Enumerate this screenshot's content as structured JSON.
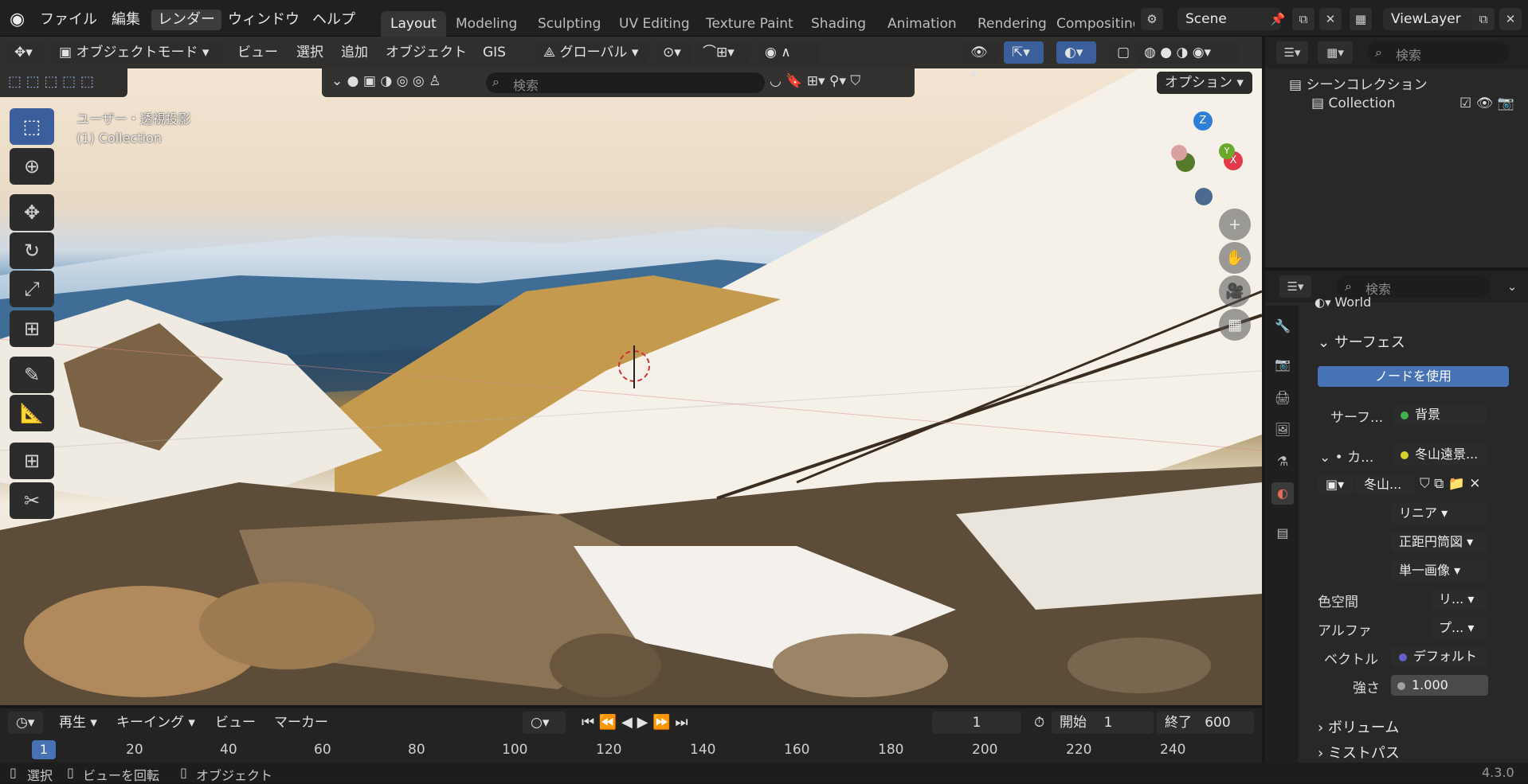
{
  "topbar": {
    "menus": [
      "ファイル",
      "編集",
      "レンダー",
      "ウィンドウ",
      "ヘルプ"
    ],
    "active_menu": "レンダー",
    "workspaces": [
      "Layout",
      "Modeling",
      "Sculpting",
      "UV Editing",
      "Texture Paint",
      "Shading",
      "Animation",
      "Rendering",
      "Compositing"
    ],
    "active_workspace": "Layout",
    "scene": "Scene",
    "view_layer": "ViewLayer"
  },
  "viewport_header": {
    "mode": "オブジェクトモード",
    "menus": [
      "ビュー",
      "選択",
      "追加",
      "オブジェクト",
      "GIS"
    ],
    "transform": "グローバル",
    "search_placeholder": "検索",
    "options": "オプション"
  },
  "viewport": {
    "view_name": "ユーザー・透視投影",
    "collection": "(1) Collection",
    "gizmo": {
      "z": "Z",
      "x": "X",
      "y": "Y"
    }
  },
  "outliner": {
    "search_placeholder": "検索",
    "scene_collection": "シーンコレクション",
    "collection": "Collection"
  },
  "properties": {
    "search_placeholder": "検索",
    "world_name": "World",
    "surface_section": "サーフェス",
    "use_nodes": "ノードを使用",
    "surface_label": "サーフ...",
    "surface_value": "背景",
    "color_label": "カ...",
    "color_value": "冬山遠景...",
    "image_name": "冬山...",
    "interpolation": "リニア",
    "projection": "正距円筒図",
    "source": "単一画像",
    "colorspace_label": "色空間",
    "colorspace_value": "リ...",
    "alpha_label": "アルファ",
    "alpha_value": "プ...",
    "vector_label": "ベクトル",
    "vector_value": "デフォルト",
    "strength_label": "強さ",
    "strength_value": "1.000",
    "volume_section": "ボリューム",
    "mistpass_section": "ミストパス"
  },
  "timeline": {
    "play_menu": "再生",
    "keying_menu": "キーイング",
    "view_menu": "ビュー",
    "marker_menu": "マーカー",
    "current_frame": "1",
    "start_label": "開始",
    "start_value": "1",
    "end_label": "終了",
    "end_value": "600",
    "ticks": [
      "20",
      "40",
      "60",
      "80",
      "100",
      "120",
      "140",
      "160",
      "180",
      "200",
      "220",
      "240"
    ],
    "frame_badge": "1"
  },
  "status": {
    "select": "選択",
    "rotate": "ビューを回転",
    "object": "オブジェクト",
    "version": "4.3.0"
  },
  "colors": {
    "accent": "#4772b3",
    "x_axis": "#e03a4b",
    "y_axis": "#6aa82e",
    "z_axis": "#2f7fd8"
  }
}
